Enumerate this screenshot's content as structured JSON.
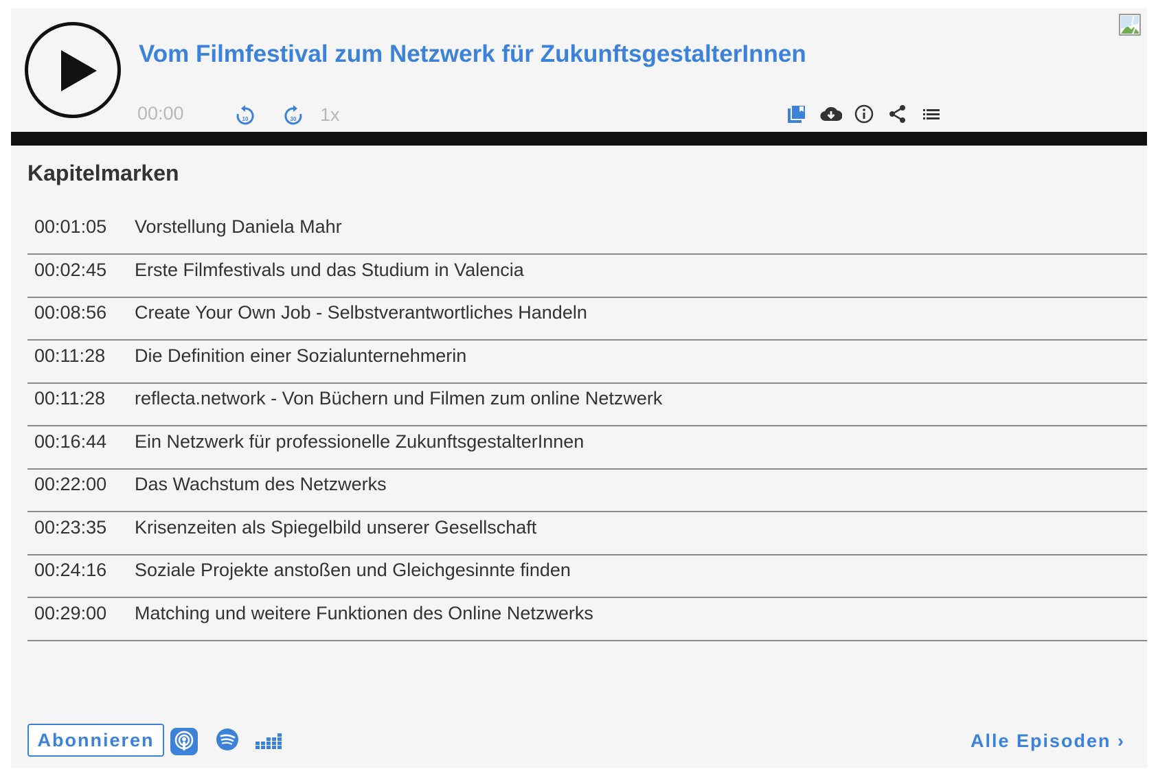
{
  "player": {
    "title": "Vom Filmfestival zum Netzwerk für ZukunftsgestalterInnen",
    "current_time": "00:00",
    "rewind_seconds": "10",
    "forward_seconds": "30",
    "speed": "1x",
    "progress": 0,
    "accent_color": "#3d82d9"
  },
  "toolbar_icons": [
    "chapters-icon",
    "download-icon",
    "info-icon",
    "share-icon",
    "playlist-icon"
  ],
  "chapters": {
    "heading": "Kapitelmarken",
    "items": [
      {
        "time": "00:01:05",
        "title": "Vorstellung Daniela Mahr"
      },
      {
        "time": "00:02:45",
        "title": "Erste Filmfestivals und das Studium in Valencia"
      },
      {
        "time": "00:08:56",
        "title": "Create Your Own Job - Selbstverantwortliches Handeln"
      },
      {
        "time": "00:11:28",
        "title": "Die Definition einer Sozialunternehmerin"
      },
      {
        "time": "00:11:28",
        "title": "reflecta.network - Von Büchern und Filmen zum online Netzwerk"
      },
      {
        "time": "00:16:44",
        "title": "Ein Netzwerk für professionelle ZukunftsgestalterInnen"
      },
      {
        "time": "00:22:00",
        "title": "Das Wachstum des Netzwerks"
      },
      {
        "time": "00:23:35",
        "title": "Krisenzeiten als Spiegelbild unserer Gesellschaft"
      },
      {
        "time": "00:24:16",
        "title": "Soziale Projekte anstoßen und Gleichgesinnte finden"
      },
      {
        "time": "00:29:00",
        "title": "Matching und weitere Funktionen des Online Netzwerks"
      }
    ]
  },
  "footer": {
    "subscribe_label": "Abonnieren",
    "platform_icons": [
      "apple-podcasts-icon",
      "spotify-icon",
      "deezer-icon"
    ],
    "all_episodes_label": "Alle Episoden ›"
  }
}
